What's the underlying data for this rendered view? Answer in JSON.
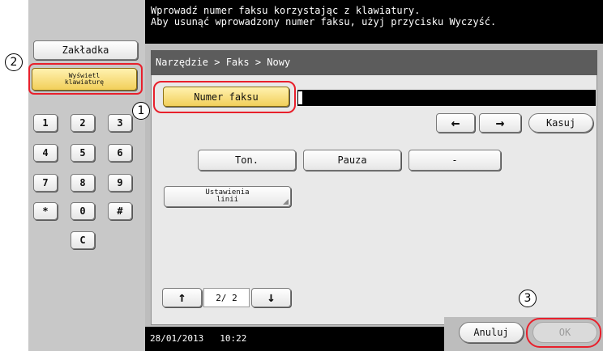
{
  "header": {
    "line1": "Wprowadź numer faksu korzystając z klawiatury.",
    "line2": "Aby usunąć wprowadzony numer faksu, użyj przycisku Wyczyść."
  },
  "left_panel": {
    "bookmark_label": "Zakładka",
    "show_keypad_label": "Wyświetl klawiaturę",
    "keypad": [
      "1",
      "2",
      "3",
      "4",
      "5",
      "6",
      "7",
      "8",
      "9",
      "*",
      "0",
      "#",
      "C"
    ]
  },
  "breadcrumb": "Narzędzie > Faks > Nowy",
  "fax_number": {
    "button_label": "Numer faksu",
    "value": ""
  },
  "controls": {
    "left_arrow": "←",
    "right_arrow": "→",
    "clear_label": "Kasuj",
    "tone_label": "Ton.",
    "pause_label": "Pauza",
    "dash_label": "-",
    "line_settings_label": "Ustawienia linii"
  },
  "pager": {
    "up": "↑",
    "page_text": "2/ 2",
    "down": "↓"
  },
  "footer": {
    "date": "28/01/2013",
    "time": "10:22",
    "cancel_label": "Anuluj",
    "ok_label": "OK"
  },
  "callouts": [
    "1",
    "2",
    "3"
  ],
  "colors": {
    "highlight": "#e8202c",
    "gold_button": "#f2cf5a",
    "header_bg": "#000000",
    "breadcrumb_bg": "#5c5c5c"
  }
}
